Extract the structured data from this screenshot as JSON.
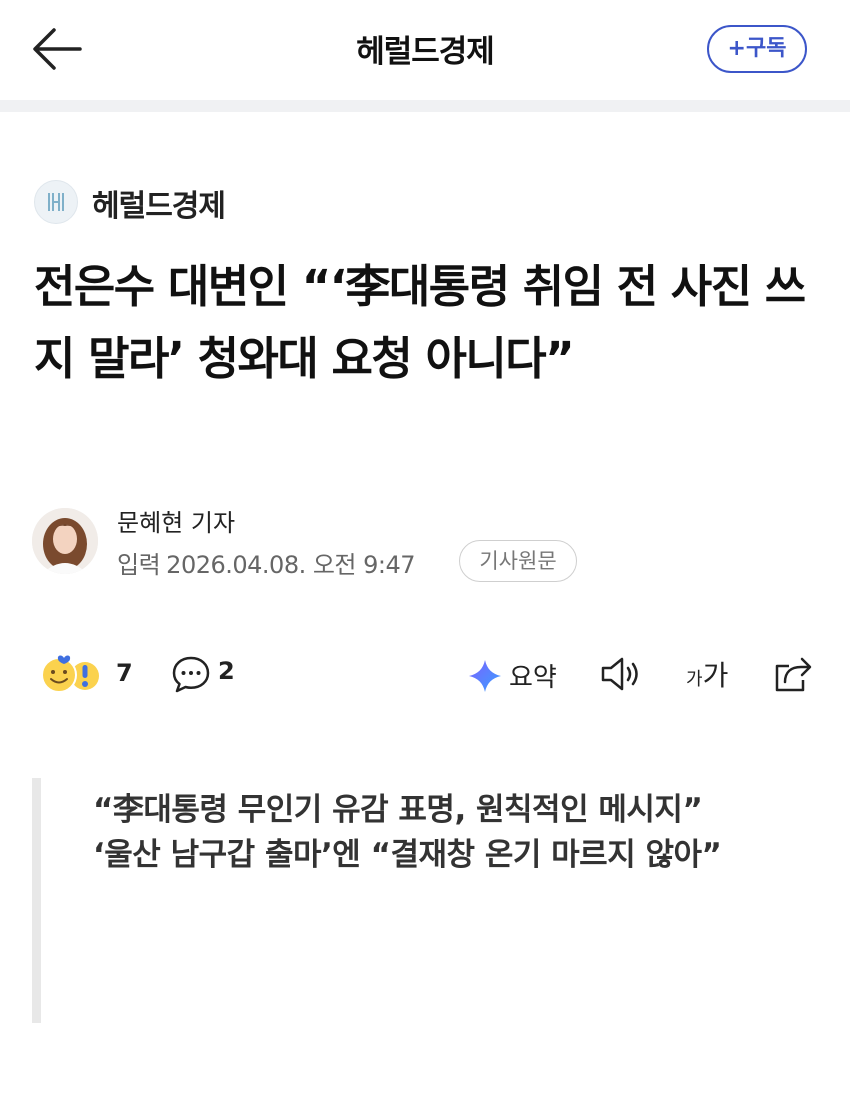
{
  "header": {
    "title": "헤럴드경제",
    "subscribe_label": "+구독"
  },
  "press": {
    "name": "헤럴드경제",
    "logo_icon": "press-logo-icon"
  },
  "article": {
    "headline": "전은수 대변인 “‘李대통령 취임 전 사진 쓰지 말라’ 청와대 요청 아니다”",
    "reporter": "문혜현 기자",
    "input_label": "입력",
    "input_datetime": "2026.04.08. 오전 9:47",
    "original_label": "기사원문"
  },
  "actions": {
    "reaction_count": "7",
    "comment_count": "2",
    "summary_label": "요약",
    "font_small": "가",
    "font_big": "가"
  },
  "summary": {
    "lines": [
      "“李대통령 무인기 유감 표명, 원칙적인 메시지”",
      "‘울산 남구갑 출마’엔 “결재창 온기 마르지 않아”"
    ]
  },
  "colors": {
    "accent": "#3c56c9",
    "divider_band": "#f0f1f3",
    "quote_bar": "#e8e8e8"
  }
}
